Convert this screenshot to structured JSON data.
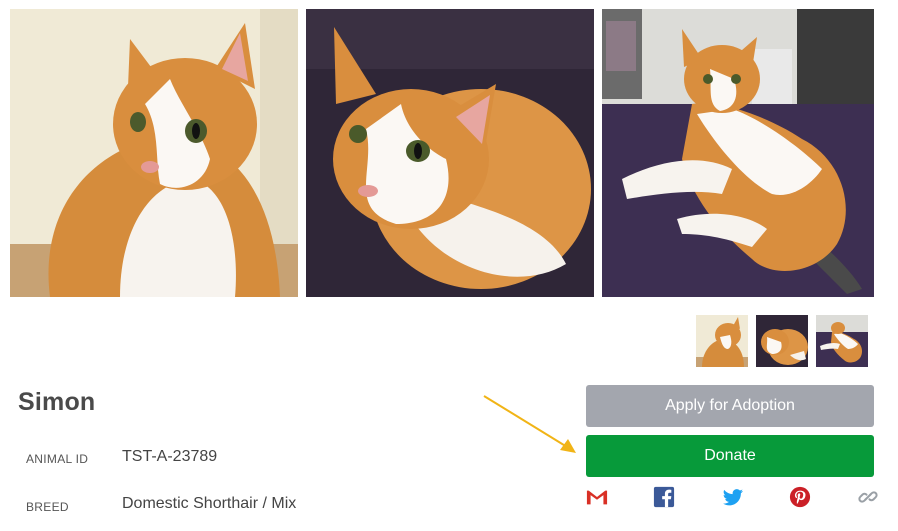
{
  "pet": {
    "name": "Simon",
    "fields": [
      {
        "label": "ANIMAL ID",
        "value": "TST-A-23789"
      },
      {
        "label": "BREED",
        "value": "Domestic Shorthair / Mix"
      }
    ]
  },
  "actions": {
    "apply_label": "Apply for Adoption",
    "donate_label": "Donate"
  },
  "share_icons": [
    "gmail-icon",
    "facebook-icon",
    "twitter-icon",
    "pinterest-icon",
    "link-icon"
  ],
  "colors": {
    "apply_bg": "#a3a6ae",
    "donate_bg": "#079a3a",
    "arrow": "#f1b416",
    "gmail": "#d93025",
    "facebook": "#3b5998",
    "twitter": "#1da1f2",
    "pinterest": "#cb2027",
    "link": "#9aa0a6"
  }
}
